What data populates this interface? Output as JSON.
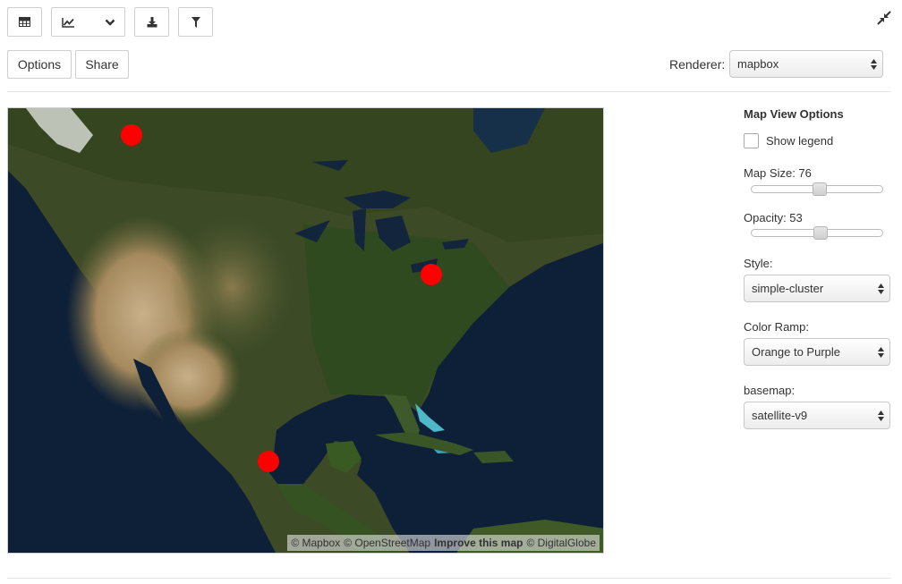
{
  "toolbar": {
    "icons": [
      "table-icon",
      "line-chart-icon",
      "chevron-down-icon",
      "download-icon",
      "filter-icon",
      "collapse-icon"
    ]
  },
  "actions": {
    "options_label": "Options",
    "share_label": "Share"
  },
  "renderer": {
    "label": "Renderer:",
    "value": "mapbox"
  },
  "map": {
    "marker_color": "#ff0000",
    "attribution": {
      "mapbox": "© Mapbox",
      "osm": "© OpenStreetMap",
      "improve": "Improve this map",
      "globe": "© DigitalGlobe"
    }
  },
  "panel": {
    "title": "Map View Options",
    "show_legend_label": "Show legend",
    "show_legend_checked": false,
    "map_size_label": "Map Size: 76",
    "map_size_value": 76,
    "opacity_label": "Opacity: 53",
    "opacity_value": 53,
    "style_label": "Style:",
    "style_value": "simple-cluster",
    "color_ramp_label": "Color Ramp:",
    "color_ramp_value": "Orange to Purple",
    "basemap_label": "basemap:",
    "basemap_value": "satellite-v9"
  }
}
